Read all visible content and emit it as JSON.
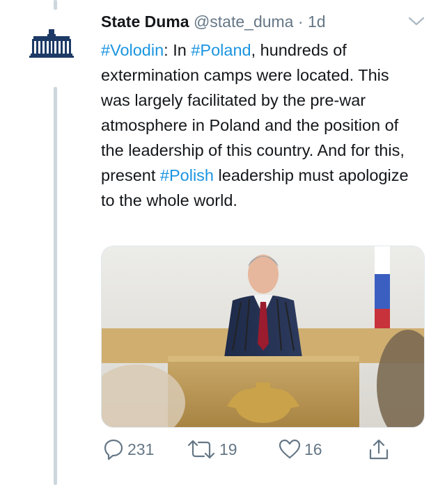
{
  "tweet": {
    "display_name": "State Duma",
    "handle": "@state_duma",
    "separator": "·",
    "time": "1d",
    "text_segments": [
      {
        "text": "#Volodin",
        "type": "hashtag"
      },
      {
        "text": ": In ",
        "type": "text"
      },
      {
        "text": "#Poland",
        "type": "hashtag"
      },
      {
        "text": ", hundreds of extermination camps were located. This was largely facilitated by the pre-war atmosphere in Poland and the position of the leadership of this country. And for this, present ",
        "type": "text"
      },
      {
        "text": "#Polish",
        "type": "hashtag"
      },
      {
        "text": " leadership must apologize to the whole world.",
        "type": "text"
      }
    ],
    "media": {
      "alt": "Man in a dark suit speaking at a podium in the State Duma with a gold double-headed eagle emblem on the rostrum"
    },
    "actions": {
      "reply": {
        "count": "231",
        "icon": "reply-icon"
      },
      "retweet": {
        "count": "19",
        "icon": "retweet-icon"
      },
      "like": {
        "count": "16",
        "icon": "like-icon"
      },
      "share": {
        "icon": "share-icon"
      }
    }
  },
  "colors": {
    "hashtag": "#1b95e0",
    "secondary_text": "#657786",
    "thread_line": "#ccd6dd",
    "avatar_blue": "#1d3a66"
  }
}
